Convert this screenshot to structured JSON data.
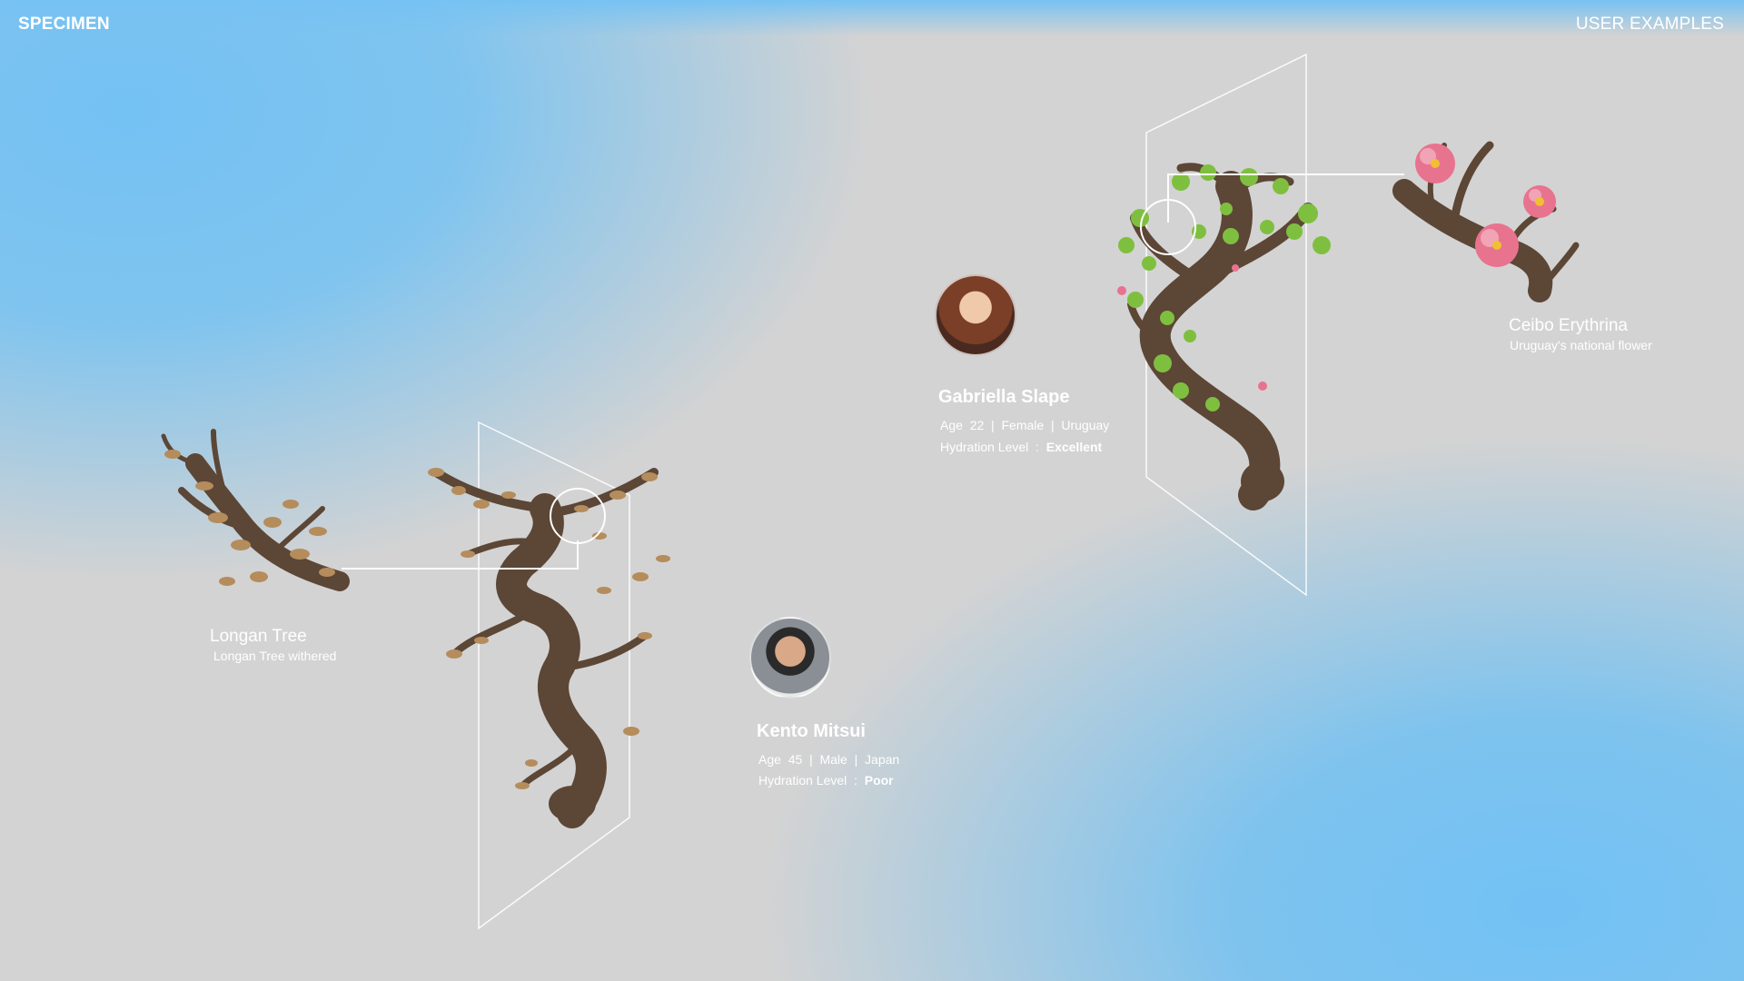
{
  "header": {
    "brand": "SPECIMEN",
    "nav_link": "USER EXAMPLES"
  },
  "users": [
    {
      "name": "Gabriella Slape",
      "age_label": "Age",
      "age": "22",
      "gender": "Female",
      "country": "Uruguay",
      "hydration_label": "Hydration Level",
      "hydration_value": "Excellent",
      "avatar_icon": "portrait-woman"
    },
    {
      "name": "Kento Mitsui",
      "age_label": "Age",
      "age": "45",
      "gender": "Male",
      "country": "Japan",
      "hydration_label": "Hydration Level",
      "hydration_value": "Poor",
      "avatar_icon": "portrait-man"
    }
  ],
  "specimens": [
    {
      "title": "Ceibo Erythrina",
      "subtitle": "Uruguay's national flower"
    },
    {
      "title": "Longan Tree",
      "subtitle": "Longan Tree withered"
    }
  ],
  "colors": {
    "sky_blue": "#74c1f4",
    "background_grey": "#d3d3d3",
    "trunk_brown": "#5c4636",
    "leaf_green": "#7fbf3f",
    "withered_leaf": "#b58c5c",
    "flower_pink": "#e8738f"
  }
}
